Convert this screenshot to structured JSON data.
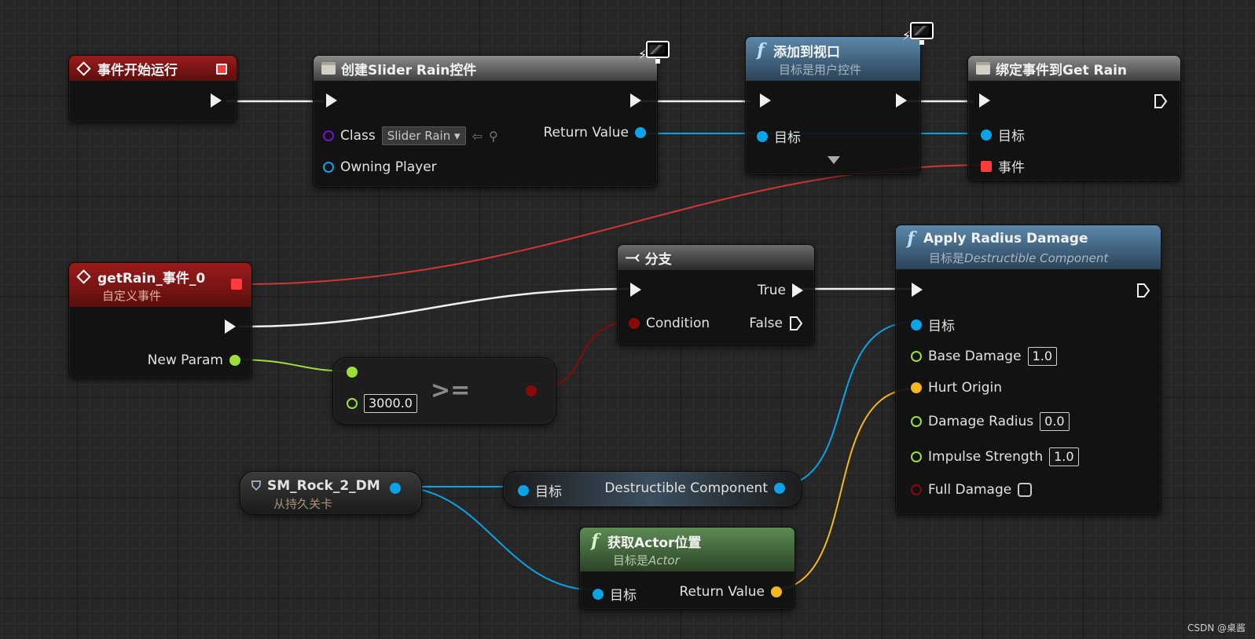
{
  "nodes": {
    "begin_play": {
      "title": "事件开始运行"
    },
    "create_widget": {
      "title": "创建Slider Rain控件",
      "class_label": "Class",
      "class_value": "Slider Rain",
      "owning_player_label": "Owning Player",
      "return_value_label": "Return Value"
    },
    "add_to_viewport": {
      "title": "添加到视口",
      "subtitle": "目标是用户控件",
      "target_label": "目标"
    },
    "bind_event": {
      "title": "绑定事件到Get Rain",
      "target_label": "目标",
      "event_label": "事件"
    },
    "custom_event": {
      "title": "getRain_事件_0",
      "subtitle": "自定义事件",
      "new_param_label": "New Param"
    },
    "compare": {
      "op": ">=",
      "value": "3000.0"
    },
    "branch": {
      "title": "分支",
      "true_label": "True",
      "condition_label": "Condition",
      "false_label": "False"
    },
    "apply_damage": {
      "title": "Apply Radius Damage",
      "subtitle_prefix": "目标是",
      "subtitle_class": "Destructible Component",
      "target_label": "目标",
      "base_damage_label": "Base Damage",
      "base_damage_value": "1.0",
      "hurt_origin_label": "Hurt Origin",
      "damage_radius_label": "Damage Radius",
      "damage_radius_value": "0.0",
      "impulse_label": "Impulse Strength",
      "impulse_value": "1.0",
      "full_damage_label": "Full Damage"
    },
    "actor_ref": {
      "title": "SM_Rock_2_DM",
      "subtitle": "从持久关卡"
    },
    "get_component": {
      "target_label": "目标",
      "output_label": "Destructible Component"
    },
    "get_location": {
      "title": "获取Actor位置",
      "subtitle_prefix": "目标是",
      "subtitle_class": "Actor",
      "target_label": "目标",
      "return_value_label": "Return Value"
    }
  },
  "icons": {
    "function": "f-function-icon",
    "event": "event-diamond-icon",
    "struct": "struct-icon",
    "branch": "branch-icon",
    "client_server": "monitor-icon"
  },
  "colors": {
    "exec": "#f0f0f0",
    "object": "#0aa3e8",
    "float": "#9cde3a",
    "vector": "#f5b71f",
    "bool": "#8a0a0a",
    "delegate": "#ff3b3b",
    "class": "#6a18c9"
  },
  "watermark": "CSDN @桌酱"
}
